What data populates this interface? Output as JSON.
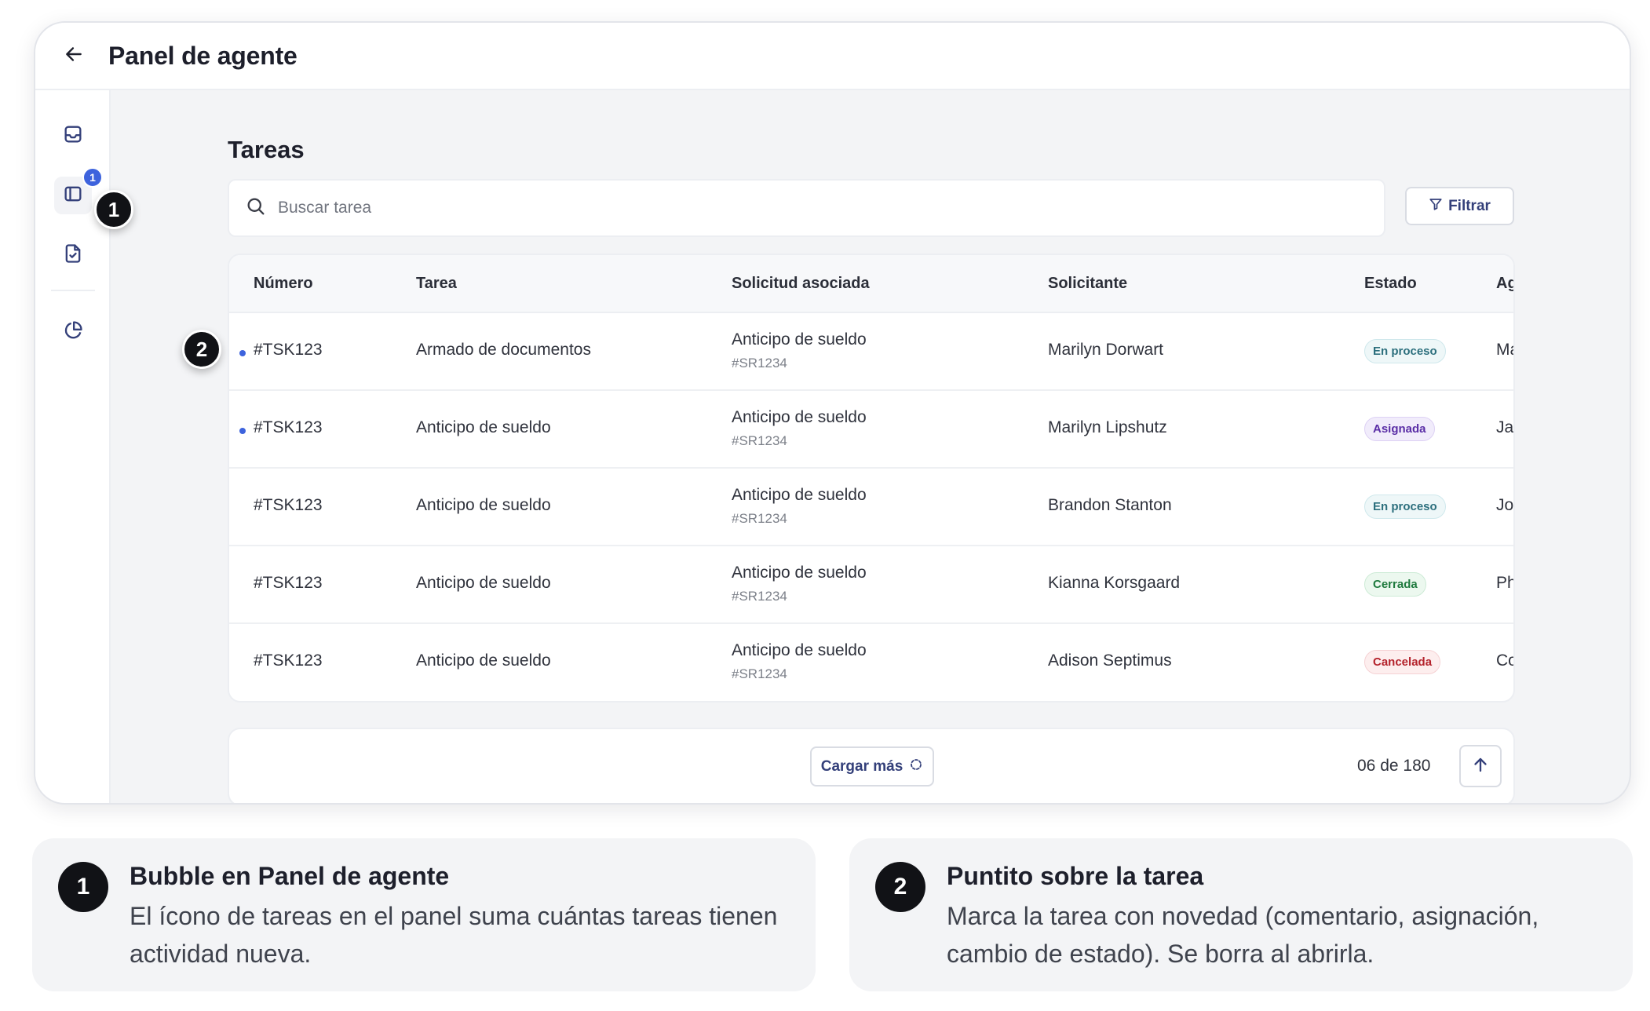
{
  "header": {
    "title": "Panel de agente"
  },
  "sidebar": {
    "tasks_badge": "1"
  },
  "callouts": {
    "one": "1",
    "two": "2"
  },
  "tasks": {
    "title": "Tareas",
    "search_placeholder": "Buscar tarea",
    "filter_label": "Filtrar",
    "columns": [
      "Número",
      "Tarea",
      "Solicitud asociada",
      "Solicitante",
      "Estado",
      "Ag"
    ],
    "rows": [
      {
        "number": "#TSK123",
        "task": "Armado de documentos",
        "request": "Anticipo de sueldo",
        "request_id": "#SR1234",
        "requester": "Marilyn Dorwart",
        "status": "En proceso",
        "agent": "Ma"
      },
      {
        "number": "#TSK123",
        "task": "Anticipo de sueldo",
        "request": "Anticipo de sueldo",
        "request_id": "#SR1234",
        "requester": "Marilyn Lipshutz",
        "status": "Asignada",
        "agent": "Ja"
      },
      {
        "number": "#TSK123",
        "task": "Anticipo de sueldo",
        "request": "Anticipo de sueldo",
        "request_id": "#SR1234",
        "requester": "Brandon Stanton",
        "status": "En proceso",
        "agent": "Jo"
      },
      {
        "number": "#TSK123",
        "task": "Anticipo de sueldo",
        "request": "Anticipo de sueldo",
        "request_id": "#SR1234",
        "requester": "Kianna Korsgaard",
        "status": "Cerrada",
        "agent": "Ph"
      },
      {
        "number": "#TSK123",
        "task": "Anticipo de sueldo",
        "request": "Anticipo de sueldo",
        "request_id": "#SR1234",
        "requester": "Adison Septimus",
        "status": "Cancelada",
        "agent": "Co"
      }
    ],
    "load_more": "Cargar más",
    "page_count": "06 de 180"
  },
  "notes": [
    {
      "num": "1",
      "title": "Bubble en Panel de agente",
      "body": "El ícono de tareas en el panel suma cuántas tareas tienen actividad nueva."
    },
    {
      "num": "2",
      "title": "Puntito sobre la tarea",
      "body": "Marca la tarea con novedad (comentario, asignación, cambio de estado). Se borra al abrirla."
    }
  ],
  "colors": {
    "accent": "#3d63dd",
    "marker": "#111216",
    "status_en_proceso": "#2c6f7d",
    "status_asignada": "#5a2ea6",
    "status_cerrada": "#1f7a3e",
    "status_cancelada": "#b4232c"
  },
  "icons": {
    "back": "arrow-left-icon",
    "nav": [
      "inbox-icon",
      "tasks-panel-icon",
      "document-check-icon",
      "pie-chart-icon"
    ],
    "search": "search-icon",
    "filter": "filter-icon",
    "load_more": "spinner-icon",
    "scroll_top": "arrow-up-icon"
  }
}
